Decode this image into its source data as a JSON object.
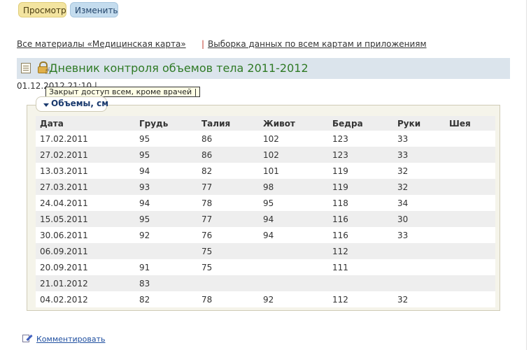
{
  "toolbar": {
    "view_label": "Просмотр",
    "edit_label": "Изменить"
  },
  "links": {
    "all_materials": "Все материалы «Медицинская карта»",
    "separator": "|",
    "data_selection": "Выборка данных по всем картам и приложениям"
  },
  "title": {
    "text": "Дневник контроля объемов тела 2011-2012"
  },
  "date_line": "01.12.2012 21:10 |",
  "tooltip": "Закрыт доступ всем, кроме врачей |",
  "legend": "Объемы, см",
  "table": {
    "headers": [
      "Дата",
      "Грудь",
      "Талия",
      "Живот",
      "Бедра",
      "Руки",
      "Шея"
    ],
    "rows": [
      [
        "17.02.2011",
        "95",
        "86",
        "102",
        "123",
        "33",
        ""
      ],
      [
        "27.02.2011",
        "95",
        "86",
        "102",
        "123",
        "33",
        ""
      ],
      [
        "13.03.2011",
        "94",
        "82",
        "101",
        "119",
        "32",
        ""
      ],
      [
        "27.03.2011",
        "93",
        "77",
        "98",
        "119",
        "32",
        ""
      ],
      [
        "24.04.2011",
        "94",
        "78",
        "95",
        "118",
        "34",
        ""
      ],
      [
        "15.05.2011",
        "95",
        "77",
        "94",
        "116",
        "30",
        ""
      ],
      [
        "30.06.2011",
        "92",
        "76",
        "94",
        "116",
        "33",
        ""
      ],
      [
        "06.09.2011",
        "",
        "75",
        "",
        "112",
        "",
        ""
      ],
      [
        "20.09.2011",
        "91",
        "75",
        "",
        "111",
        "",
        ""
      ],
      [
        "21.01.2012",
        "83",
        "",
        "",
        "",
        "",
        ""
      ],
      [
        "04.02.2012",
        "82",
        "78",
        "92",
        "112",
        "32",
        ""
      ]
    ]
  },
  "footer": {
    "comment_label": "Комментировать"
  },
  "icons": {
    "doc": "document-icon",
    "lock": "lock-icon",
    "cursor": "hand-cursor-icon",
    "comment": "edit-pencil-icon"
  },
  "colors": {
    "title": "#2f7a25",
    "title_bar": "#dbe4ec",
    "view_tab": "#f3e4a0",
    "edit_tab": "#c4dcee",
    "link_blue": "#1f4fa0"
  }
}
